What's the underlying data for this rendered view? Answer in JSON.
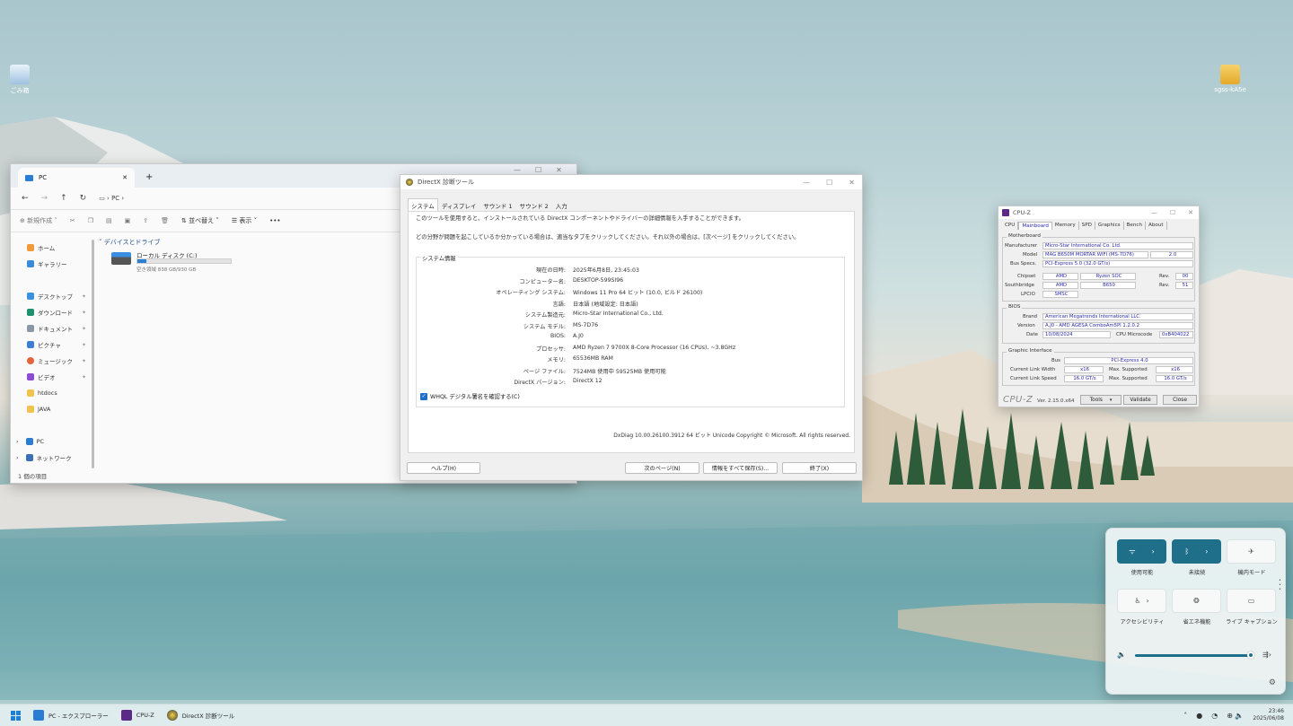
{
  "desktop": {
    "icons": [
      {
        "label": "ごみ箱"
      },
      {
        "label": "sgss-kA5e"
      }
    ]
  },
  "explorer": {
    "tab_title": "PC",
    "address": "PC",
    "toolbar": {
      "new_label": "新規作成",
      "sort_label": "並べ替え",
      "view_label": "表示",
      "more_label": "•••"
    },
    "nav": {
      "items": [
        {
          "label": "ホーム"
        },
        {
          "label": "ギャラリー"
        },
        {
          "label": "デスクトップ"
        },
        {
          "label": "ダウンロード"
        },
        {
          "label": "ドキュメント"
        },
        {
          "label": "ピクチャ"
        },
        {
          "label": "ミュージック"
        },
        {
          "label": "ビデオ"
        },
        {
          "label": "htdocs"
        },
        {
          "label": "JAVA"
        },
        {
          "label": "PC"
        },
        {
          "label": "ネットワーク"
        }
      ]
    },
    "section_header": "デバイスとドライブ",
    "drive": {
      "name": "ローカル ディスク (C:)",
      "free": "空き領域 838 GB/930 GB",
      "used_fraction": 0.1
    },
    "status": "1 個の項目"
  },
  "dxdiag": {
    "title": "DirectX 診断ツール",
    "tabs": [
      "システム",
      "ディスプレイ",
      "サウンド 1",
      "サウンド 2",
      "入力"
    ],
    "intro1": "このツールを使用すると、インストールされている DirectX コンポーネントやドライバーの詳細情報を入手することができます。",
    "intro2": "どの分野が問題を起こしているか分かっている場合は、適当なタブをクリックしてください。それ以外の場合は、[次ページ] をクリックしてください。",
    "group_label": "システム情報",
    "info": [
      {
        "k": "現在の日時:",
        "v": "2025年6月8日, 23:45:03"
      },
      {
        "k": "コンピューター名:",
        "v": "DESKTOP-599SI96"
      },
      {
        "k": "オペレーティング システム:",
        "v": "Windows 11 Pro 64 ビット (10.0, ビルド 26100)"
      },
      {
        "k": "言語:",
        "v": "日本語 (地域設定: 日本語)"
      },
      {
        "k": "システム製造元:",
        "v": "Micro-Star International Co., Ltd."
      },
      {
        "k": "システム モデル:",
        "v": "MS-7D76"
      },
      {
        "k": "BIOS:",
        "v": "A.J0"
      },
      {
        "k": "プロセッサ:",
        "v": "AMD Ryzen 7 9700X 8-Core Processor          (16 CPUs), ~3.8GHz"
      },
      {
        "k": "メモリ:",
        "v": "65536MB RAM"
      },
      {
        "k": "ページ ファイル:",
        "v": "7524MB 使用中 59525MB 使用可能"
      },
      {
        "k": "DirectX バージョン:",
        "v": "DirectX 12"
      }
    ],
    "whql": "WHQL デジタル署名を確認する(C)",
    "footer": "DxDiag 10.00.26100.3912 64 ビット Unicode  Copyright © Microsoft. All rights reserved.",
    "buttons": {
      "help": "ヘルプ(H)",
      "next": "次のページ(N)",
      "save": "情報をすべて保存(S)...",
      "exit": "終了(X)"
    }
  },
  "cpuz": {
    "title": "CPU-Z",
    "tabs": [
      "CPU",
      "Mainboard",
      "Memory",
      "SPD",
      "Graphics",
      "Bench",
      "About"
    ],
    "motherboard_label": "Motherboard",
    "manufacturer_label": "Manufacturer",
    "manufacturer": "Micro-Star International Co. Ltd.",
    "model_label": "Model",
    "model": "MAG B650M MORTAR WIFI (MS-7D76)",
    "model_rev": "2.0",
    "busspecs_label": "Bus Specs.",
    "busspecs": "PCI-Express 5.0 (32.0 GT/s)",
    "chipset_label": "Chipset",
    "chipset_vendor": "AMD",
    "chipset": "Ryzen SOC",
    "chipset_rev_label": "Rev.",
    "chipset_rev": "00",
    "southbridge_label": "Southbridge",
    "southbridge_vendor": "AMD",
    "southbridge": "B650",
    "southbridge_rev_label": "Rev.",
    "southbridge_rev": "51",
    "lpcio_label": "LPCIO",
    "lpcio": "SMSC",
    "bios_label": "BIOS",
    "brand_label": "Brand",
    "brand": "American Megatrends International LLC.",
    "version_label": "Version",
    "version": "A.J0 - AMD AGESA ComboAm5PI 1.2.0.2",
    "date_label": "Date",
    "date": "10/08/2024",
    "microcode_label": "CPU Microcode",
    "microcode": "0xB404022",
    "gi_label": "Graphic Interface",
    "bus_label": "Bus",
    "bus": "PCI-Express 4.0",
    "link_width_label": "Current Link Width",
    "link_width": "x16",
    "max_width_label": "Max. Supported",
    "max_width": "x16",
    "link_speed_label": "Current Link Speed",
    "link_speed": "16.0 GT/s",
    "max_speed_label": "Max. Supported",
    "max_speed": "16.0 GT/s",
    "logo": "CPU-Z",
    "ver": "Ver. 2.15.0.x64",
    "tools": "Tools",
    "validate": "Validate",
    "close": "Close"
  },
  "quick_settings": {
    "tiles": [
      {
        "label": "使用可能"
      },
      {
        "label": "未接続"
      },
      {
        "label": "機内モード"
      },
      {
        "label": "アクセシビリティ"
      },
      {
        "label": "省エネ機能"
      },
      {
        "label": "ライブ キャプション"
      }
    ],
    "volume_fraction": 0.98
  },
  "taskbar": {
    "apps": [
      {
        "label": "PC - エクスプローラー"
      },
      {
        "label": "CPU-Z"
      },
      {
        "label": "DirectX 診断ツール"
      }
    ],
    "time": "23:46",
    "date": "2025/06/08"
  },
  "colors": {
    "accent": "#1f6f8b",
    "cpuz_value": "#2a2aa8"
  }
}
